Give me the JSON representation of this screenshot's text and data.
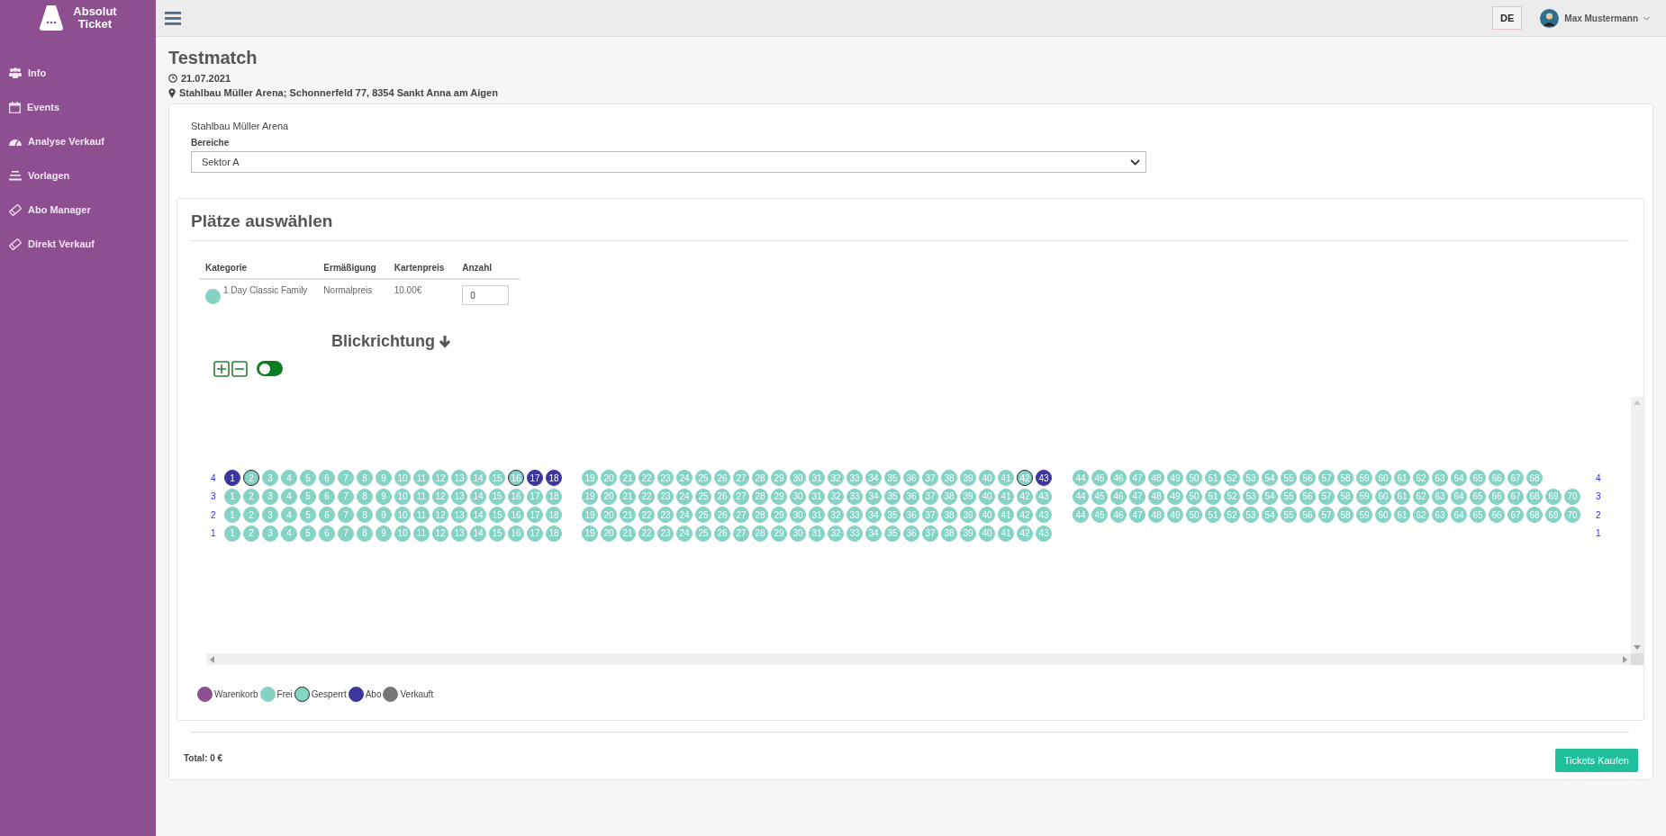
{
  "brand": {
    "line1": "Absolut",
    "line2": "Ticket"
  },
  "sidebar": {
    "items": [
      {
        "label": "Info"
      },
      {
        "label": "Events"
      },
      {
        "label": "Analyse Verkauf"
      },
      {
        "label": "Vorlagen"
      },
      {
        "label": "Abo Manager"
      },
      {
        "label": "Direkt Verkauf"
      }
    ]
  },
  "header": {
    "language": "DE",
    "user": "Max Mustermann"
  },
  "event": {
    "title": "Testmatch",
    "date": "21.07.2021",
    "location": "Stahlbau Müller Arena; Schonnerfeld 77, 8354 Sankt Anna am Aigen"
  },
  "venue": {
    "name": "Stahlbau Müller Arena",
    "area_label": "Bereiche",
    "area_value": "Sektor A"
  },
  "seat_panel": {
    "title": "Plätze auswählen",
    "table": {
      "columns": [
        "Kategorie",
        "Ermäßigung",
        "Kartenpreis",
        "Anzahl"
      ],
      "rows": [
        {
          "category": "1 Day Classic Family",
          "color": "#84d3c5",
          "discount": "Normalpreis",
          "price": "10.00€",
          "quantity": "0"
        }
      ]
    },
    "view_direction": "Blickrichtung",
    "toggle": {
      "on": false
    },
    "rows": [
      {
        "label": "4",
        "blocks": [
          [
            {
              "n": "1",
              "kind": "abo"
            },
            {
              "n": "2",
              "kind": "gesperrt"
            },
            {
              "n": "3",
              "kind": "frei"
            },
            {
              "n": "4",
              "kind": "frei"
            },
            {
              "n": "5",
              "kind": "frei"
            },
            {
              "n": "6",
              "kind": "frei"
            },
            {
              "n": "7",
              "kind": "frei"
            },
            {
              "n": "8",
              "kind": "frei"
            },
            {
              "n": "9",
              "kind": "frei"
            },
            {
              "n": "10",
              "kind": "frei"
            },
            {
              "n": "11",
              "kind": "frei"
            },
            {
              "n": "12",
              "kind": "frei"
            },
            {
              "n": "13",
              "kind": "frei"
            },
            {
              "n": "14",
              "kind": "frei"
            },
            {
              "n": "15",
              "kind": "frei"
            },
            {
              "n": "16",
              "kind": "gesperrt"
            },
            {
              "n": "17",
              "kind": "abo"
            },
            {
              "n": "18",
              "kind": "abo"
            }
          ],
          [
            {
              "n": "19",
              "kind": "frei"
            },
            {
              "n": "20",
              "kind": "frei"
            },
            {
              "n": "21",
              "kind": "frei"
            },
            {
              "n": "22",
              "kind": "frei"
            },
            {
              "n": "23",
              "kind": "frei"
            },
            {
              "n": "24",
              "kind": "frei"
            },
            {
              "n": "25",
              "kind": "frei"
            },
            {
              "n": "26",
              "kind": "frei"
            },
            {
              "n": "27",
              "kind": "frei"
            },
            {
              "n": "28",
              "kind": "frei"
            },
            {
              "n": "29",
              "kind": "frei"
            },
            {
              "n": "30",
              "kind": "frei"
            },
            {
              "n": "31",
              "kind": "frei"
            },
            {
              "n": "32",
              "kind": "frei"
            },
            {
              "n": "33",
              "kind": "frei"
            },
            {
              "n": "34",
              "kind": "frei"
            },
            {
              "n": "35",
              "kind": "frei"
            },
            {
              "n": "36",
              "kind": "frei"
            },
            {
              "n": "37",
              "kind": "frei"
            },
            {
              "n": "38",
              "kind": "frei"
            },
            {
              "n": "39",
              "kind": "frei"
            },
            {
              "n": "40",
              "kind": "frei"
            },
            {
              "n": "41",
              "kind": "frei"
            },
            {
              "n": "42",
              "kind": "gesperrt"
            },
            {
              "n": "43",
              "kind": "abo"
            }
          ],
          [
            {
              "n": "44",
              "kind": "frei"
            },
            {
              "n": "45",
              "kind": "frei"
            },
            {
              "n": "46",
              "kind": "frei"
            },
            {
              "n": "47",
              "kind": "frei"
            },
            {
              "n": "48",
              "kind": "frei"
            },
            {
              "n": "49",
              "kind": "frei"
            },
            {
              "n": "50",
              "kind": "frei"
            },
            {
              "n": "51",
              "kind": "frei"
            },
            {
              "n": "52",
              "kind": "frei"
            },
            {
              "n": "53",
              "kind": "frei"
            },
            {
              "n": "54",
              "kind": "frei"
            },
            {
              "n": "55",
              "kind": "frei"
            },
            {
              "n": "56",
              "kind": "frei"
            },
            {
              "n": "57",
              "kind": "frei"
            },
            {
              "n": "58",
              "kind": "frei"
            },
            {
              "n": "59",
              "kind": "frei"
            },
            {
              "n": "60",
              "kind": "frei"
            },
            {
              "n": "61",
              "kind": "frei"
            },
            {
              "n": "62",
              "kind": "frei"
            },
            {
              "n": "63",
              "kind": "frei"
            },
            {
              "n": "64",
              "kind": "frei"
            },
            {
              "n": "65",
              "kind": "frei"
            },
            {
              "n": "66",
              "kind": "frei"
            },
            {
              "n": "67",
              "kind": "frei"
            },
            {
              "n": "68",
              "kind": "frei"
            }
          ]
        ],
        "end_label": "4"
      },
      {
        "label": "3",
        "blocks": [
          [
            {
              "n": "1",
              "kind": "frei"
            },
            {
              "n": "2",
              "kind": "frei"
            },
            {
              "n": "3",
              "kind": "frei"
            },
            {
              "n": "4",
              "kind": "frei"
            },
            {
              "n": "5",
              "kind": "frei"
            },
            {
              "n": "6",
              "kind": "frei"
            },
            {
              "n": "7",
              "kind": "frei"
            },
            {
              "n": "8",
              "kind": "frei"
            },
            {
              "n": "9",
              "kind": "frei"
            },
            {
              "n": "10",
              "kind": "frei"
            },
            {
              "n": "11",
              "kind": "frei"
            },
            {
              "n": "12",
              "kind": "frei"
            },
            {
              "n": "13",
              "kind": "frei"
            },
            {
              "n": "14",
              "kind": "frei"
            },
            {
              "n": "15",
              "kind": "frei"
            },
            {
              "n": "16",
              "kind": "frei"
            },
            {
              "n": "17",
              "kind": "frei"
            },
            {
              "n": "18",
              "kind": "frei"
            }
          ],
          [
            {
              "n": "19",
              "kind": "frei"
            },
            {
              "n": "20",
              "kind": "frei"
            },
            {
              "n": "21",
              "kind": "frei"
            },
            {
              "n": "22",
              "kind": "frei"
            },
            {
              "n": "23",
              "kind": "frei"
            },
            {
              "n": "24",
              "kind": "frei"
            },
            {
              "n": "25",
              "kind": "frei"
            },
            {
              "n": "26",
              "kind": "frei"
            },
            {
              "n": "27",
              "kind": "frei"
            },
            {
              "n": "28",
              "kind": "frei"
            },
            {
              "n": "29",
              "kind": "frei"
            },
            {
              "n": "30",
              "kind": "frei"
            },
            {
              "n": "31",
              "kind": "frei"
            },
            {
              "n": "32",
              "kind": "frei"
            },
            {
              "n": "33",
              "kind": "frei"
            },
            {
              "n": "34",
              "kind": "frei"
            },
            {
              "n": "35",
              "kind": "frei"
            },
            {
              "n": "36",
              "kind": "frei"
            },
            {
              "n": "37",
              "kind": "frei"
            },
            {
              "n": "38",
              "kind": "frei"
            },
            {
              "n": "39",
              "kind": "frei"
            },
            {
              "n": "40",
              "kind": "frei"
            },
            {
              "n": "41",
              "kind": "frei"
            },
            {
              "n": "42",
              "kind": "frei"
            },
            {
              "n": "43",
              "kind": "frei"
            }
          ],
          [
            {
              "n": "44",
              "kind": "frei"
            },
            {
              "n": "45",
              "kind": "frei"
            },
            {
              "n": "46",
              "kind": "frei"
            },
            {
              "n": "47",
              "kind": "frei"
            },
            {
              "n": "48",
              "kind": "frei"
            },
            {
              "n": "49",
              "kind": "frei"
            },
            {
              "n": "50",
              "kind": "frei"
            },
            {
              "n": "51",
              "kind": "frei"
            },
            {
              "n": "52",
              "kind": "frei"
            },
            {
              "n": "53",
              "kind": "frei"
            },
            {
              "n": "54",
              "kind": "frei"
            },
            {
              "n": "55",
              "kind": "frei"
            },
            {
              "n": "56",
              "kind": "frei"
            },
            {
              "n": "57",
              "kind": "frei"
            },
            {
              "n": "58",
              "kind": "frei"
            },
            {
              "n": "59",
              "kind": "frei"
            },
            {
              "n": "60",
              "kind": "frei"
            },
            {
              "n": "61",
              "kind": "frei"
            },
            {
              "n": "62",
              "kind": "frei"
            },
            {
              "n": "63",
              "kind": "frei"
            },
            {
              "n": "64",
              "kind": "frei"
            },
            {
              "n": "65",
              "kind": "frei"
            },
            {
              "n": "66",
              "kind": "frei"
            },
            {
              "n": "67",
              "kind": "frei"
            },
            {
              "n": "68",
              "kind": "frei"
            },
            {
              "n": "69",
              "kind": "frei"
            },
            {
              "n": "70",
              "kind": "frei"
            }
          ]
        ],
        "end_label": "3"
      },
      {
        "label": "2",
        "blocks": [
          [
            {
              "n": "1",
              "kind": "frei"
            },
            {
              "n": "2",
              "kind": "frei"
            },
            {
              "n": "3",
              "kind": "frei"
            },
            {
              "n": "4",
              "kind": "frei"
            },
            {
              "n": "5",
              "kind": "frei"
            },
            {
              "n": "6",
              "kind": "frei"
            },
            {
              "n": "7",
              "kind": "frei"
            },
            {
              "n": "8",
              "kind": "frei"
            },
            {
              "n": "9",
              "kind": "frei"
            },
            {
              "n": "10",
              "kind": "frei"
            },
            {
              "n": "11",
              "kind": "frei"
            },
            {
              "n": "12",
              "kind": "frei"
            },
            {
              "n": "13",
              "kind": "frei"
            },
            {
              "n": "14",
              "kind": "frei"
            },
            {
              "n": "15",
              "kind": "frei"
            },
            {
              "n": "16",
              "kind": "frei"
            },
            {
              "n": "17",
              "kind": "frei"
            },
            {
              "n": "18",
              "kind": "frei"
            }
          ],
          [
            {
              "n": "19",
              "kind": "frei"
            },
            {
              "n": "20",
              "kind": "frei"
            },
            {
              "n": "21",
              "kind": "frei"
            },
            {
              "n": "22",
              "kind": "frei"
            },
            {
              "n": "23",
              "kind": "frei"
            },
            {
              "n": "24",
              "kind": "frei"
            },
            {
              "n": "25",
              "kind": "frei"
            },
            {
              "n": "26",
              "kind": "frei"
            },
            {
              "n": "27",
              "kind": "frei"
            },
            {
              "n": "28",
              "kind": "frei"
            },
            {
              "n": "29",
              "kind": "frei"
            },
            {
              "n": "30",
              "kind": "frei"
            },
            {
              "n": "31",
              "kind": "frei"
            },
            {
              "n": "32",
              "kind": "frei"
            },
            {
              "n": "33",
              "kind": "frei"
            },
            {
              "n": "34",
              "kind": "frei"
            },
            {
              "n": "35",
              "kind": "frei"
            },
            {
              "n": "36",
              "kind": "frei"
            },
            {
              "n": "37",
              "kind": "frei"
            },
            {
              "n": "38",
              "kind": "frei"
            },
            {
              "n": "39",
              "kind": "frei"
            },
            {
              "n": "40",
              "kind": "frei"
            },
            {
              "n": "41",
              "kind": "frei"
            },
            {
              "n": "42",
              "kind": "frei"
            },
            {
              "n": "43",
              "kind": "frei"
            }
          ],
          [
            {
              "n": "44",
              "kind": "frei"
            },
            {
              "n": "45",
              "kind": "frei"
            },
            {
              "n": "46",
              "kind": "frei"
            },
            {
              "n": "47",
              "kind": "frei"
            },
            {
              "n": "48",
              "kind": "frei"
            },
            {
              "n": "49",
              "kind": "frei"
            },
            {
              "n": "50",
              "kind": "frei"
            },
            {
              "n": "51",
              "kind": "frei"
            },
            {
              "n": "52",
              "kind": "frei"
            },
            {
              "n": "53",
              "kind": "frei"
            },
            {
              "n": "54",
              "kind": "frei"
            },
            {
              "n": "55",
              "kind": "frei"
            },
            {
              "n": "56",
              "kind": "frei"
            },
            {
              "n": "57",
              "kind": "frei"
            },
            {
              "n": "58",
              "kind": "frei"
            },
            {
              "n": "59",
              "kind": "frei"
            },
            {
              "n": "60",
              "kind": "frei"
            },
            {
              "n": "61",
              "kind": "frei"
            },
            {
              "n": "62",
              "kind": "frei"
            },
            {
              "n": "63",
              "kind": "frei"
            },
            {
              "n": "64",
              "kind": "frei"
            },
            {
              "n": "65",
              "kind": "frei"
            },
            {
              "n": "66",
              "kind": "frei"
            },
            {
              "n": "67",
              "kind": "frei"
            },
            {
              "n": "68",
              "kind": "frei"
            },
            {
              "n": "69",
              "kind": "frei"
            },
            {
              "n": "70",
              "kind": "frei"
            }
          ]
        ],
        "end_label": "2"
      },
      {
        "label": "1",
        "blocks": [
          [
            {
              "n": "1",
              "kind": "frei"
            },
            {
              "n": "2",
              "kind": "frei"
            },
            {
              "n": "3",
              "kind": "frei"
            },
            {
              "n": "4",
              "kind": "frei"
            },
            {
              "n": "5",
              "kind": "frei"
            },
            {
              "n": "6",
              "kind": "frei"
            },
            {
              "n": "7",
              "kind": "frei"
            },
            {
              "n": "8",
              "kind": "frei"
            },
            {
              "n": "9",
              "kind": "frei"
            },
            {
              "n": "10",
              "kind": "frei"
            },
            {
              "n": "11",
              "kind": "frei"
            },
            {
              "n": "12",
              "kind": "frei"
            },
            {
              "n": "13",
              "kind": "frei"
            },
            {
              "n": "14",
              "kind": "frei"
            },
            {
              "n": "15",
              "kind": "frei"
            },
            {
              "n": "16",
              "kind": "frei"
            },
            {
              "n": "17",
              "kind": "frei"
            },
            {
              "n": "18",
              "kind": "frei"
            }
          ],
          [
            {
              "n": "19",
              "kind": "frei"
            },
            {
              "n": "20",
              "kind": "frei"
            },
            {
              "n": "21",
              "kind": "frei"
            },
            {
              "n": "22",
              "kind": "frei"
            },
            {
              "n": "23",
              "kind": "frei"
            },
            {
              "n": "24",
              "kind": "frei"
            },
            {
              "n": "25",
              "kind": "frei"
            },
            {
              "n": "26",
              "kind": "frei"
            },
            {
              "n": "27",
              "kind": "frei"
            },
            {
              "n": "28",
              "kind": "frei"
            },
            {
              "n": "29",
              "kind": "frei"
            },
            {
              "n": "30",
              "kind": "frei"
            },
            {
              "n": "31",
              "kind": "frei"
            },
            {
              "n": "32",
              "kind": "frei"
            },
            {
              "n": "33",
              "kind": "frei"
            },
            {
              "n": "34",
              "kind": "frei"
            },
            {
              "n": "35",
              "kind": "frei"
            },
            {
              "n": "36",
              "kind": "frei"
            },
            {
              "n": "37",
              "kind": "frei"
            },
            {
              "n": "38",
              "kind": "frei"
            },
            {
              "n": "39",
              "kind": "frei"
            },
            {
              "n": "40",
              "kind": "frei"
            },
            {
              "n": "41",
              "kind": "frei"
            },
            {
              "n": "42",
              "kind": "frei"
            },
            {
              "n": "43",
              "kind": "frei"
            }
          ]
        ],
        "end_label": "1"
      }
    ],
    "legend": [
      {
        "label": "Warenkorb",
        "kind": "warenkorb"
      },
      {
        "label": "Frei",
        "kind": "frei"
      },
      {
        "label": "Gesperrt",
        "kind": "gesperrt"
      },
      {
        "label": "Abo",
        "kind": "abo"
      },
      {
        "label": "Verkauft",
        "kind": "verkauft"
      }
    ]
  },
  "footer": {
    "total": "Total: 0 €",
    "button": "Tickets Kaufen"
  }
}
